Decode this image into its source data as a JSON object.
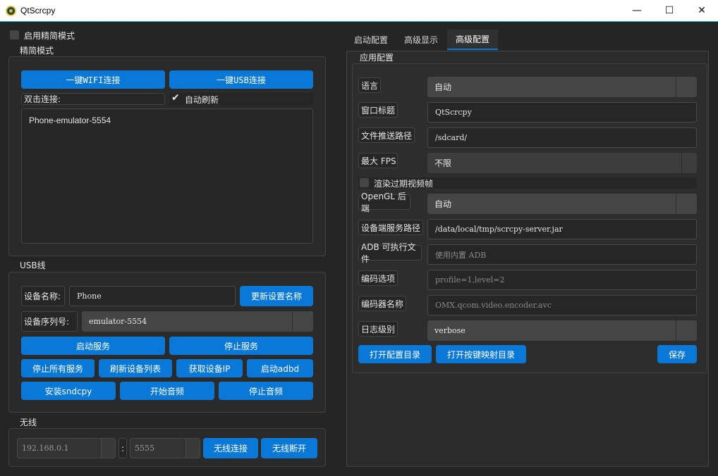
{
  "window": {
    "title": "QtScrcpy",
    "minimize": "—",
    "maximize": "☐",
    "close": "✕"
  },
  "left": {
    "simple_mode_label": "启用精简模式",
    "simple_group": {
      "title": "精简模式",
      "wifi_btn": "一键WIFI连接",
      "usb_btn": "一键USB连接",
      "dblclick_label": "双击连接:",
      "auto_refresh_label": "自动刷新",
      "devices": [
        "Phone-emulator-5554"
      ]
    },
    "usb_group": {
      "title": "USB线",
      "device_name_label": "设备名称:",
      "device_name_value": "Phone",
      "update_name_btn": "更新设置名称",
      "serial_label": "设备序列号:",
      "serial_value": "emulator-5554",
      "start_service_btn": "启动服务",
      "stop_service_btn": "停止服务",
      "stop_all_btn": "停止所有服务",
      "refresh_devices_btn": "刷新设备列表",
      "get_ip_btn": "获取设备IP",
      "start_adbd_btn": "启动adbd",
      "install_sndcpy_btn": "安装sndcpy",
      "start_audio_btn": "开始音频",
      "stop_audio_btn": "停止音频"
    },
    "wireless_group": {
      "title": "无线",
      "ip_value": "192.168.0.1",
      "separator": ":",
      "port_value": "5555",
      "connect_btn": "无线连接",
      "disconnect_btn": "无线断开"
    }
  },
  "right": {
    "tabs": [
      "启动配置",
      "高级显示",
      "高级配置"
    ],
    "active_tab": 2,
    "app_config": {
      "title": "应用配置",
      "language_label": "语言",
      "language_value": "自动",
      "window_title_label": "窗口标题",
      "window_title_value": "QtScrcpy",
      "push_path_label": "文件推送路径",
      "push_path_value": "/sdcard/",
      "max_fps_label": "最大 FPS",
      "max_fps_value": "不限",
      "render_expired_label": "渲染过期视频帧",
      "opengl_label": "OpenGL 后端",
      "opengl_value": "自动",
      "server_path_label": "设备端服务路径",
      "server_path_value": "/data/local/tmp/scrcpy-server.jar",
      "adb_label": "ADB 可执行文件",
      "adb_placeholder": "使用内置 ADB",
      "codec_options_label": "编码选项",
      "codec_options_placeholder": "profile=1,level=2",
      "codec_name_label": "编码器名称",
      "codec_name_placeholder": "OMX.qcom.video.encoder.avc",
      "log_level_label": "日志级别",
      "log_level_value": "verbose",
      "open_config_btn": "打开配置目录",
      "open_keymap_btn": "打开按键映射目录",
      "save_btn": "保存"
    }
  }
}
